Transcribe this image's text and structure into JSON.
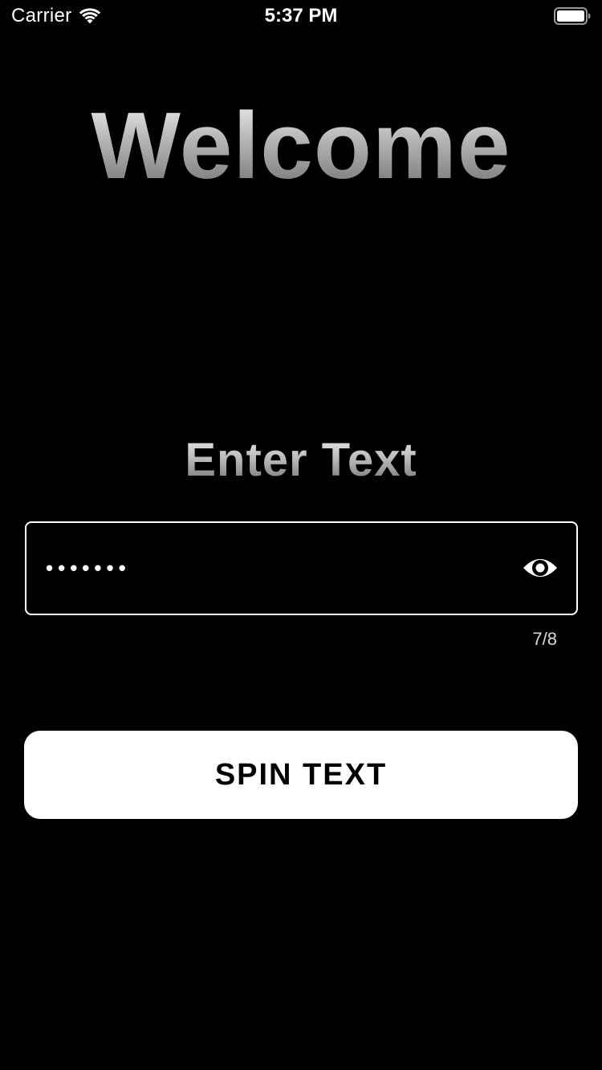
{
  "status_bar": {
    "carrier": "Carrier",
    "time": "5:37 PM",
    "wifi_icon": "wifi-icon",
    "battery_icon": "battery-full-icon"
  },
  "main": {
    "title": "Welcome",
    "subtitle": "Enter Text",
    "input": {
      "value": "•••••••",
      "masked": true,
      "toggle_icon": "eye-icon",
      "counter": "7/8"
    },
    "button_label": "SPIN TEXT"
  },
  "colors": {
    "background": "#000000",
    "button_background": "#ffffff",
    "button_text": "#000000",
    "field_border": "#ffffff"
  }
}
